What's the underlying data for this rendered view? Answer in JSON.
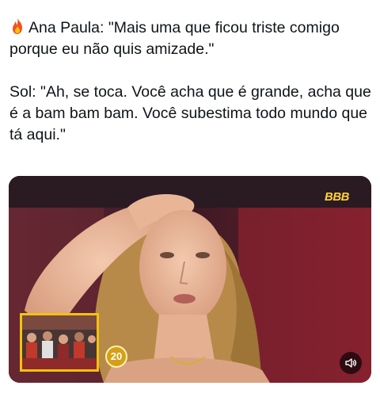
{
  "post": {
    "line1_speaker": "Ana Paula:",
    "line1_quote": "\"Mais uma que ficou triste comigo porque eu não quis amizade.\"",
    "line2_speaker": "Sol:",
    "line2_quote": "\"Ah, se toca. Você acha que é grande, acha que é a bam bam bam. Você subestima todo mundo que tá aqui.\""
  },
  "media": {
    "channel_logo": "BBB",
    "badge_number": "20",
    "sound_icon": "speaker-icon"
  }
}
